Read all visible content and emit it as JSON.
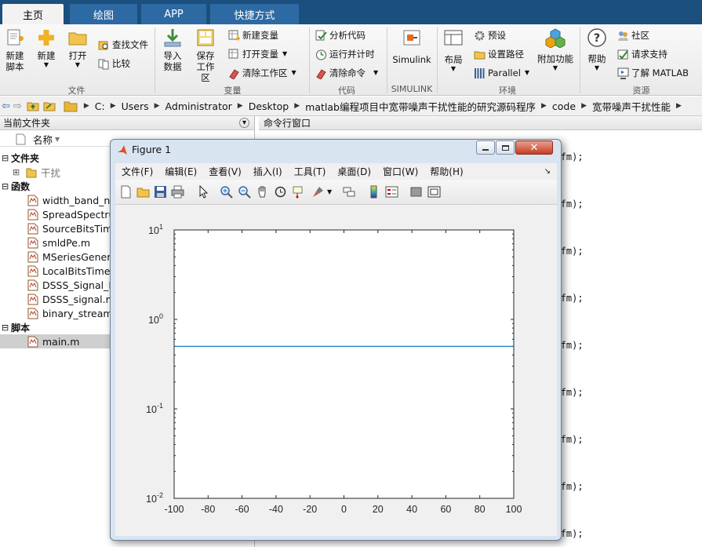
{
  "tabs": [
    "主页",
    "绘图",
    "APP",
    "快捷方式"
  ],
  "ribbon": {
    "new_script": [
      "新建",
      "脚本"
    ],
    "new": "新建",
    "open": "打开",
    "find_files": "查找文件",
    "compare": "比较",
    "import": [
      "导入",
      "数据"
    ],
    "save_ws": [
      "保存",
      "工作区"
    ],
    "new_var": "新建变量",
    "open_var": "打开变量",
    "clear_ws": "清除工作区",
    "analyze": "分析代码",
    "run_time": "运行并计时",
    "clear_cmd": "清除命令",
    "simulink": "Simulink",
    "layout": "布局",
    "prefs": "预设",
    "set_path": "设置路径",
    "parallel": "Parallel",
    "addons": "附加功能",
    "help": "帮助",
    "community": "社区",
    "support": "请求支持",
    "learn": "了解 MATLAB",
    "groups": [
      "文件",
      "变量",
      "代码",
      "SIMULINK",
      "环境",
      "资源"
    ]
  },
  "address": [
    "C:",
    "Users",
    "Administrator",
    "Desktop",
    "matlab编程项目中宽带噪声干扰性能的研究源码程序",
    "code",
    "宽带噪声干扰性能"
  ],
  "file_panel": {
    "title": "当前文件夹",
    "col_name": "名称",
    "folder_section": "文件夹",
    "folders": [
      "干扰"
    ],
    "func_section": "函数",
    "functions": [
      "width_band_no",
      "SpreadSpectru",
      "SourceBitsTime",
      "smldPe.m",
      "MSeriesGenera",
      "LocalBitsTimeS",
      "DSSS_Signal_D",
      "DSSS_signal.m",
      "binary_stream_"
    ],
    "script_section": "脚本",
    "scripts": [
      "main.m"
    ]
  },
  "command_window": {
    "title": "命令行窗口",
    "lines": [
      "j,Kfm);",
      "j,Kfm);",
      "j,Kfm);",
      "j,Kfm);",
      "j,Kfm);",
      "j,Kfm);",
      "j,Kfm);",
      "j,Kfm);",
      "j,Kfm);"
    ]
  },
  "figure": {
    "title": "Figure 1",
    "menu": [
      "文件(F)",
      "编辑(E)",
      "查看(V)",
      "插入(I)",
      "工具(T)",
      "桌面(D)",
      "窗口(W)",
      "帮助(H)"
    ]
  },
  "colors": {
    "tabbar": "#1b4f7e",
    "tab": "#2d6aa3",
    "line": "#0072bd",
    "selected_row": "#cfcfcf"
  },
  "chart_data": {
    "type": "line",
    "xlim": [
      -100,
      100
    ],
    "x_ticks": [
      -100,
      -80,
      -60,
      -40,
      -20,
      0,
      20,
      40,
      60,
      80,
      100
    ],
    "y_scale": "log",
    "ylim": [
      0.01,
      10
    ],
    "y_tick_bases": [
      "10",
      "10",
      "10",
      "10"
    ],
    "y_tick_exps": [
      "1",
      "0",
      "-1",
      "-2"
    ],
    "y_tick_values": [
      10,
      1,
      0.1,
      0.01
    ],
    "series": [
      {
        "x": [
          -100,
          100
        ],
        "y": [
          0.5,
          0.5
        ]
      }
    ]
  }
}
